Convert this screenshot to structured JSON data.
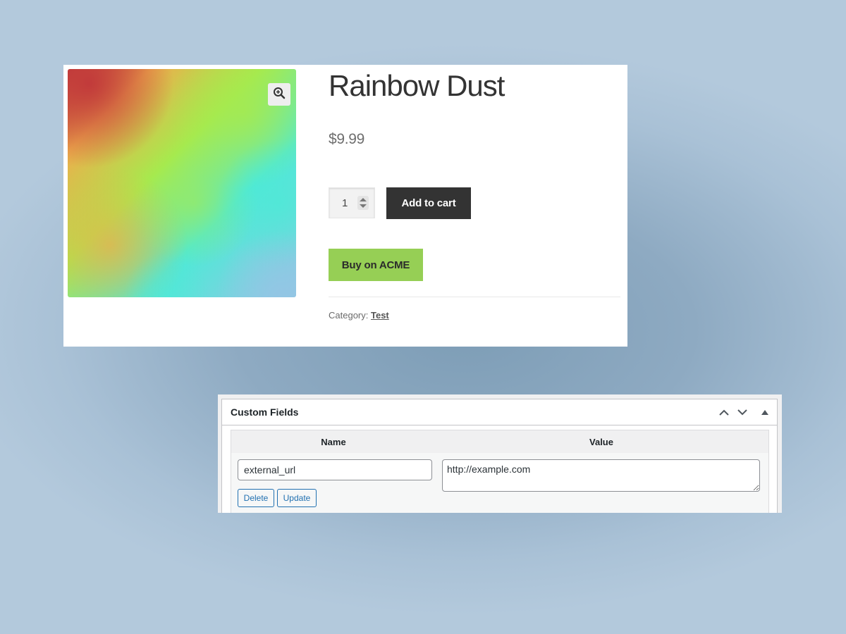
{
  "product": {
    "title": "Rainbow Dust",
    "price": "$9.99",
    "quantity": "1",
    "add_to_cart_label": "Add to cart",
    "buy_button_label": "Buy on ACME",
    "category_label": "Category:",
    "category_value": "Test",
    "image_gradient_colors": [
      "#c23b3b",
      "#eeae4c",
      "#a7ea4e",
      "#4eead7",
      "#94c6e5"
    ]
  },
  "custom_fields": {
    "title": "Custom Fields",
    "columns": {
      "name": "Name",
      "value": "Value"
    },
    "rows": [
      {
        "name": "external_url",
        "value": "http://example.com"
      }
    ],
    "delete_label": "Delete",
    "update_label": "Update"
  },
  "icons": {
    "zoom": "zoom-in-icon",
    "move_up": "chevron-up-icon",
    "move_down": "chevron-down-icon",
    "toggle": "triangle-up-icon"
  }
}
